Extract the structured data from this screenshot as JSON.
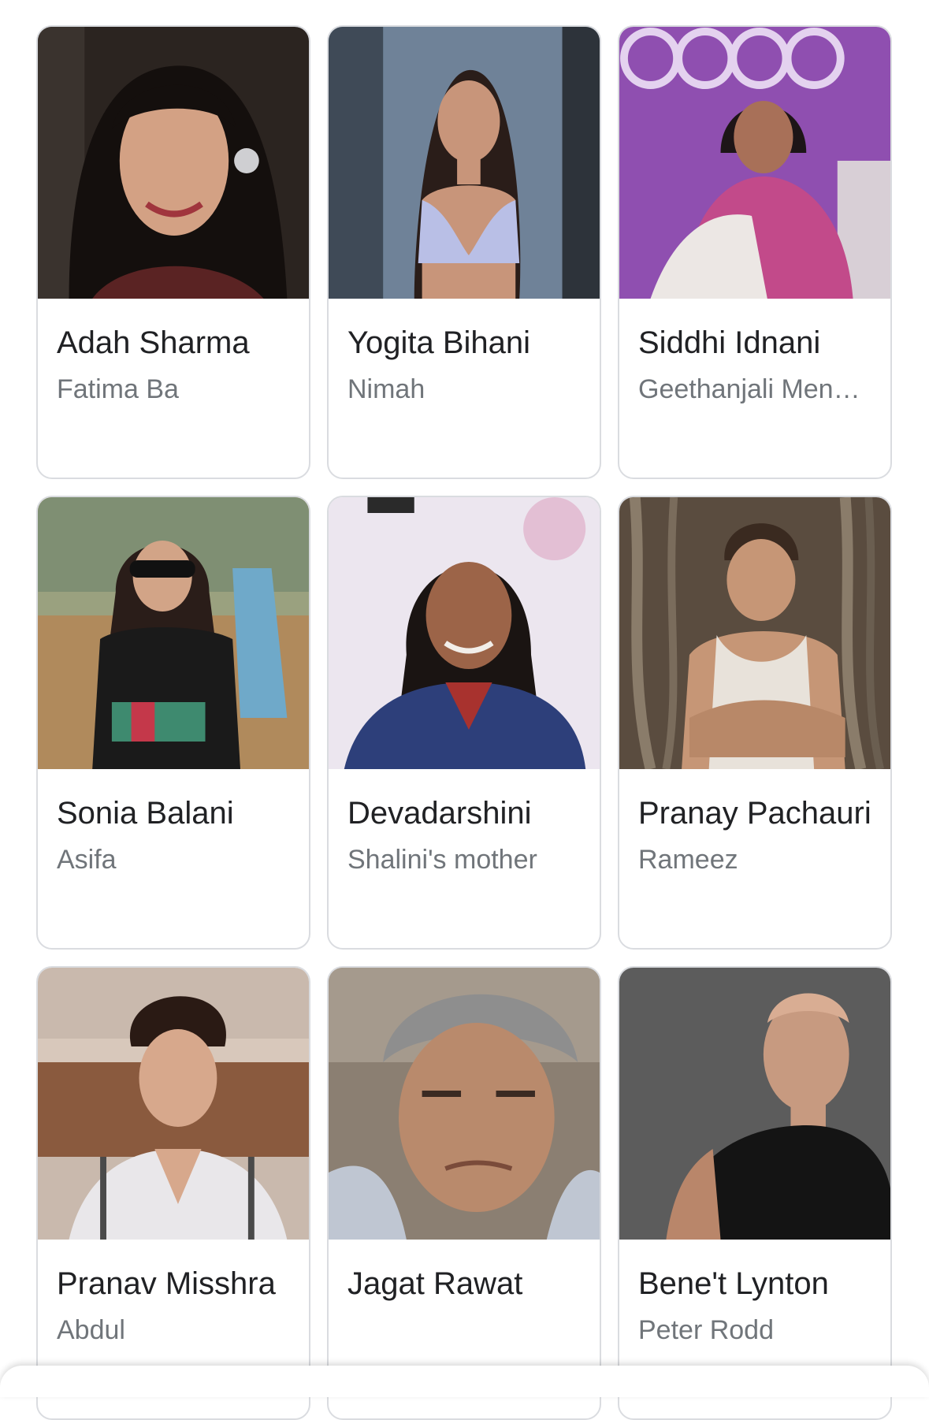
{
  "cast": [
    {
      "name": "Adah Sharma",
      "role": "Fatima Ba",
      "photo": "adah-sharma-photo",
      "bg": "#2b2420",
      "accent": "#9c6f5a"
    },
    {
      "name": "Yogita Bihani",
      "role": "Nimah",
      "photo": "yogita-bihani-photo",
      "bg": "#6f8298",
      "accent": "#b9bfe6"
    },
    {
      "name": "Siddhi Idnani",
      "role": "Geethanjali Men…",
      "photo": "siddhi-idnani-photo",
      "bg": "#8f4fb0",
      "accent": "#c24a8a"
    },
    {
      "name": "Sonia Balani",
      "role": "Asifa",
      "photo": "sonia-balani-photo",
      "bg": "#b08a5c",
      "accent": "#1a1a1a"
    },
    {
      "name": "Devadarshini",
      "role": "Shalini's mother",
      "photo": "devadarshini-photo",
      "bg": "#ece6ef",
      "accent": "#2d3f7a"
    },
    {
      "name": "Pranay Pachauri",
      "role": "Rameez",
      "photo": "pranay-pachauri-photo",
      "bg": "#5a4c3f",
      "accent": "#e8e2da"
    },
    {
      "name": "Pranav Misshra",
      "role": "Abdul",
      "photo": "pranav-misshra-photo",
      "bg": "#8a5a3e",
      "accent": "#e9e7ea"
    },
    {
      "name": "Jagat Rawat",
      "role": "",
      "photo": "jagat-rawat-photo",
      "bg": "#8b7f72",
      "accent": "#bfc6d2"
    },
    {
      "name": "Bene't Lynton",
      "role": "Peter Rodd",
      "photo": "benet-lynton-photo",
      "bg": "#5c5c5c",
      "accent": "#141414"
    }
  ]
}
